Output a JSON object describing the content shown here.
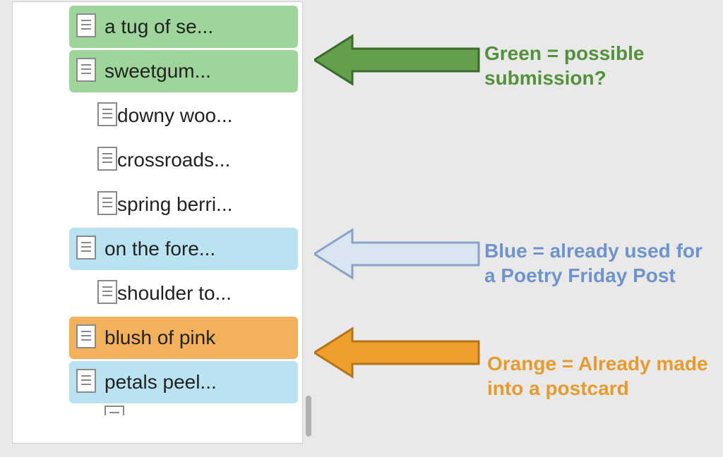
{
  "colors": {
    "green": "#53913b",
    "green_fill": "#62a04b",
    "green_row": "#9ed59a",
    "blue": "#6f94cc",
    "blue_fill": "#d9e5f1",
    "blue_row": "#b9e3f1",
    "orange": "#e59b2e",
    "orange_fill": "#ef9f2c",
    "orange_row": "#f2b15a"
  },
  "list": {
    "items": [
      {
        "label": "a tug of se...",
        "status": "green"
      },
      {
        "label": "sweetgum...",
        "status": "green"
      },
      {
        "label": "downy woo...",
        "status": "plain"
      },
      {
        "label": "crossroads...",
        "status": "plain"
      },
      {
        "label": "spring berri...",
        "status": "plain"
      },
      {
        "label": "on the fore...",
        "status": "blue"
      },
      {
        "label": "shoulder to...",
        "status": "plain"
      },
      {
        "label": "blush of pink",
        "status": "orange"
      },
      {
        "label": "petals peel...",
        "status": "blue"
      }
    ]
  },
  "legend": {
    "green": "Green = possible submission?",
    "blue": "Blue = already used for a Poetry Friday Post",
    "orange": "Orange = Already made into a postcard"
  }
}
